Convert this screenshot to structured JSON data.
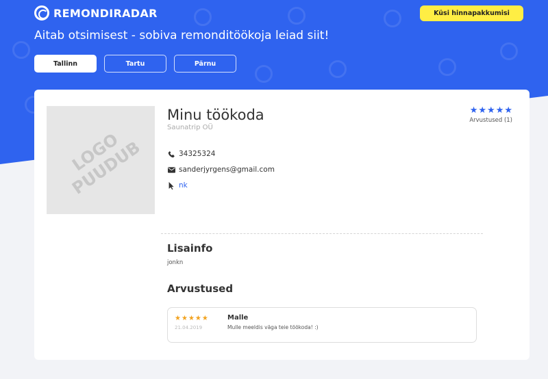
{
  "brand": {
    "name": "REMONDIRADAR",
    "accent": "#2f63ef",
    "cta_color": "#ffee44"
  },
  "header": {
    "quote_button": "Küsi hinnapakkumisi",
    "tagline": "Aitab otsimisest - sobiva remonditöökoja leiad siit!",
    "cities": [
      {
        "label": "Tallinn",
        "active": true
      },
      {
        "label": "Tartu",
        "active": false
      },
      {
        "label": "Pärnu",
        "active": false
      }
    ]
  },
  "business": {
    "logo_placeholder_line1": "LOGO",
    "logo_placeholder_line2": "PUUDUB",
    "name": "Minu töökoda",
    "company": "Saunatrip OÜ",
    "rating_stars": 5,
    "reviews_count_label": "Arvustused (1)",
    "phone": "34325324",
    "email": "sanderjyrgens@gmail.com",
    "website": "nk",
    "icons": {
      "phone": "phone-icon",
      "email": "envelope-icon",
      "website": "cursor-icon"
    }
  },
  "extra_info": {
    "title": "Lisainfo",
    "text": "jonkn"
  },
  "reviews_section": {
    "title": "Arvustused",
    "items": [
      {
        "stars": 5,
        "date": "21.04.2019",
        "author": "Malle",
        "text": "Mulle meeldis väga teie töökoda! :)"
      }
    ]
  }
}
